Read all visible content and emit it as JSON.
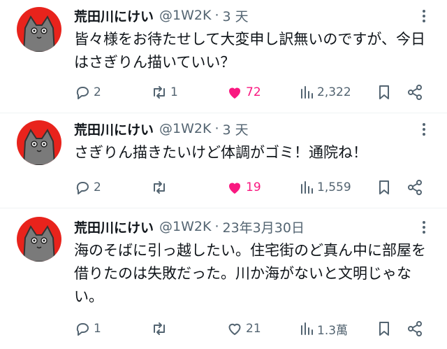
{
  "colors": {
    "accent_like": "#f91880",
    "secondary_text": "#536471",
    "avatar_bg": "#e8231c"
  },
  "tweets": [
    {
      "name": "荒田川にけい",
      "handle": "@1W2K",
      "separator": "·",
      "time": "3 天",
      "text": "皆々様をお待たせして大変申し訳無いのですが、今日はさぎりん描いていい？",
      "reply_count": "2",
      "retweet_count": "1",
      "like_count": "72",
      "liked": true,
      "view_count": "2,322"
    },
    {
      "name": "荒田川にけい",
      "handle": "@1W2K",
      "separator": "·",
      "time": "3 天",
      "text": "さぎりん描きたいけど体調がゴミ！通院ね！",
      "reply_count": "2",
      "retweet_count": "",
      "like_count": "19",
      "liked": true,
      "view_count": "1,559"
    },
    {
      "name": "荒田川にけい",
      "handle": "@1W2K",
      "separator": "·",
      "time": "23年3月30日",
      "text": "海のそばに引っ越したい。住宅街のど真ん中に部屋を借りたのは失敗だった。川か海がないと文明じゃない。",
      "reply_count": "1",
      "retweet_count": "",
      "like_count": "21",
      "liked": false,
      "view_count": "1.3萬"
    }
  ],
  "icons": [
    "avatar-cat-icon",
    "more-icon",
    "reply-icon",
    "retweet-icon",
    "like-icon",
    "views-icon",
    "bookmark-icon",
    "share-icon"
  ]
}
